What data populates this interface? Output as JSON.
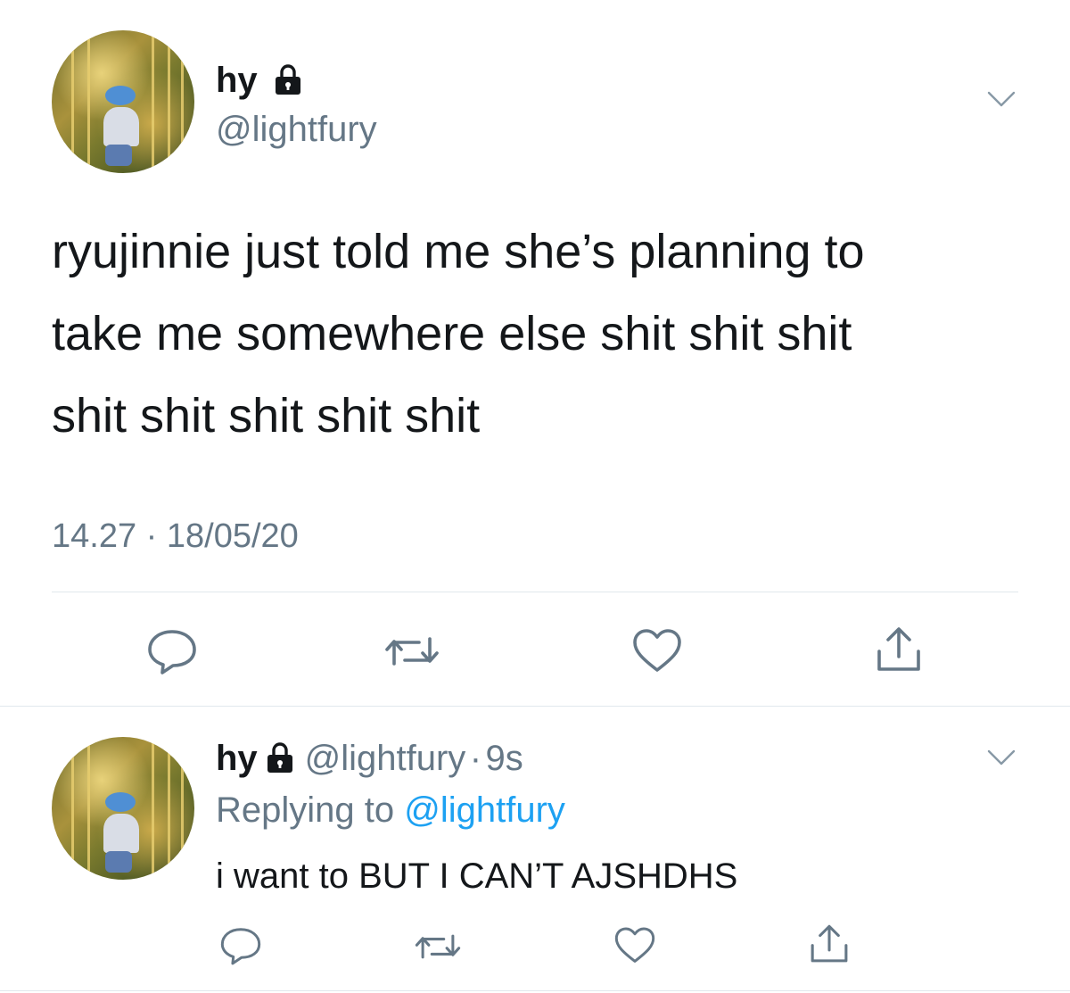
{
  "main_tweet": {
    "display_name": "hy",
    "handle": "@lightfury",
    "text_lines": [
      "ryujinnie just told me she’s planning to",
      "take me somewhere else shit shit shit",
      "shit shit shit shit shit"
    ],
    "time": "14.27",
    "separator": "·",
    "date": "18/05/20"
  },
  "reply_tweet": {
    "display_name": "hy",
    "handle": "@lightfury",
    "separator": "·",
    "age": "9s",
    "replying_prefix": "Replying to",
    "replying_handle": "@lightfury",
    "text": "i want to BUT I CAN’T AJSHDHS"
  },
  "icons": {
    "lock": "lock-icon",
    "menu": "chevron-down-icon",
    "reply": "reply-icon",
    "retweet": "retweet-icon",
    "like": "heart-icon",
    "share": "share-icon"
  },
  "colors": {
    "text": "#14171a",
    "secondary": "#657786",
    "link": "#1da1f2",
    "divider": "#e1e8ed",
    "icon": "#657786"
  }
}
